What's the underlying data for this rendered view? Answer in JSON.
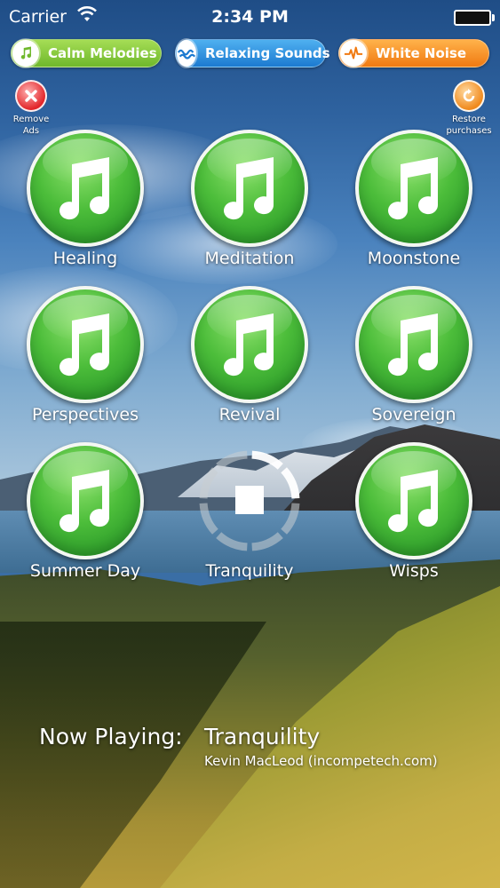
{
  "status_bar": {
    "carrier": "Carrier",
    "time": "2:34 PM",
    "battery_level": 1.0
  },
  "categories": [
    {
      "label": "Calm Melodies",
      "icon": "music-note-icon",
      "color": "#7cc63a"
    },
    {
      "label": "Relaxing Sounds",
      "icon": "waves-icon",
      "color": "#2a8ee0"
    },
    {
      "label": "White Noise",
      "icon": "heartbeat-icon",
      "color": "#f58a1f"
    }
  ],
  "remove_ads": {
    "label": "Remove Ads",
    "icon": "close-icon"
  },
  "restore_purchases": {
    "label": "Restore purchases",
    "icon": "restore-icon"
  },
  "tracks": [
    {
      "label": "Healing",
      "state": "idle"
    },
    {
      "label": "Meditation",
      "state": "idle"
    },
    {
      "label": "Moonstone",
      "state": "idle"
    },
    {
      "label": "Perspectives",
      "state": "idle"
    },
    {
      "label": "Revival",
      "state": "idle"
    },
    {
      "label": "Sovereign",
      "state": "idle"
    },
    {
      "label": "Summer Day",
      "state": "idle"
    },
    {
      "label": "Tranquility",
      "state": "playing",
      "progress": 0.27
    },
    {
      "label": "Wisps",
      "state": "idle"
    }
  ],
  "now_playing": {
    "label": "Now Playing:",
    "title": "Tranquility",
    "artist": "Kevin MacLeod (incompetech.com)"
  },
  "colors": {
    "disc_green": "#4cbd3a",
    "pill_green": "#7cc63a",
    "pill_blue": "#2a8ee0",
    "pill_orange": "#f58a1f"
  }
}
